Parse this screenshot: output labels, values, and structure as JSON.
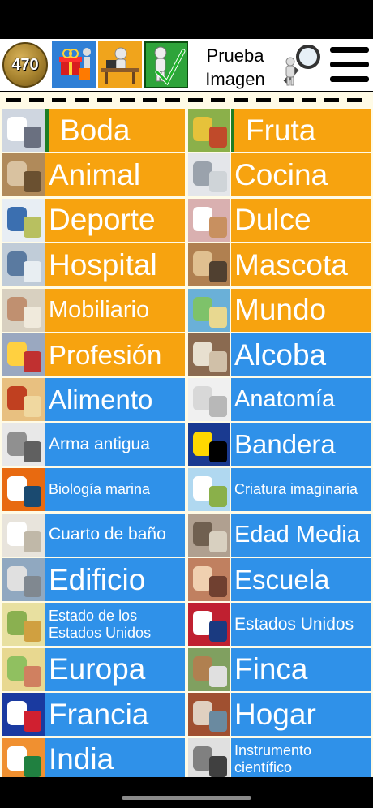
{
  "toolbar": {
    "coin_count": "470",
    "prueba_line1": "Prueba",
    "prueba_line2": "Imagen",
    "icons": [
      "gift-shop-icon",
      "desk-person-icon",
      "checkmark-person-icon",
      "magnifier-person-icon",
      "menu-icon"
    ]
  },
  "colors": {
    "orange": "#f7a30f",
    "blue": "#2f91e9",
    "selected_border": "#1d7d24",
    "background": "#fffbe6"
  },
  "categories": [
    {
      "label": "Boda",
      "color": "orange",
      "icon": "wedding-photo"
    },
    {
      "label": "Fruta",
      "color": "orange",
      "icon": "fruit-photo"
    },
    {
      "label": "Animal",
      "color": "orange",
      "icon": "animal-photo"
    },
    {
      "label": "Cocina",
      "color": "orange",
      "icon": "kitchen-photo"
    },
    {
      "label": "Deporte",
      "color": "orange",
      "icon": "sports-photo"
    },
    {
      "label": "Dulce",
      "color": "orange",
      "icon": "cake-photo"
    },
    {
      "label": "Hospital",
      "color": "orange",
      "icon": "hospital-photo"
    },
    {
      "label": "Mascota",
      "color": "orange",
      "icon": "cat-photo"
    },
    {
      "label": "Mobiliario",
      "color": "orange",
      "icon": "furniture-photo"
    },
    {
      "label": "Mundo",
      "color": "orange",
      "icon": "world-map-photo"
    },
    {
      "label": "Profesión",
      "color": "orange",
      "icon": "professions-photo"
    },
    {
      "label": "Alcoba",
      "color": "blue",
      "icon": "bedroom-photo"
    },
    {
      "label": "Alimento",
      "color": "blue",
      "icon": "pizza-photo"
    },
    {
      "label": "Anatomía",
      "color": "blue",
      "icon": "anatomy-photo"
    },
    {
      "label": "Arma antigua",
      "color": "blue",
      "icon": "ancient-weapon-photo"
    },
    {
      "label": "Bandera",
      "color": "blue",
      "icon": "flag-photo"
    },
    {
      "label": "Biología marina",
      "color": "blue",
      "icon": "clownfish-photo"
    },
    {
      "label": "Criatura imaginaria",
      "color": "blue",
      "icon": "pegasus-photo"
    },
    {
      "label": "Cuarto de baño",
      "color": "blue",
      "icon": "bathroom-photo"
    },
    {
      "label": "Edad Media",
      "color": "blue",
      "icon": "medieval-photo"
    },
    {
      "label": "Edificio",
      "color": "blue",
      "icon": "building-photo"
    },
    {
      "label": "Escuela",
      "color": "blue",
      "icon": "school-photo"
    },
    {
      "label": "Estado de los Estados Unidos",
      "color": "blue",
      "icon": "us-states-map-photo"
    },
    {
      "label": "Estados Unidos",
      "color": "blue",
      "icon": "us-map-flag-photo"
    },
    {
      "label": "Europa",
      "color": "blue",
      "icon": "europe-map-photo"
    },
    {
      "label": "Finca",
      "color": "blue",
      "icon": "farm-photo"
    },
    {
      "label": "Francia",
      "color": "blue",
      "icon": "france-flag-map-photo"
    },
    {
      "label": "Hogar",
      "color": "blue",
      "icon": "house-photo"
    },
    {
      "label": "India",
      "color": "blue",
      "icon": "india-map-photo"
    },
    {
      "label": "Instrumento científico",
      "color": "blue",
      "icon": "microscope-photo"
    }
  ]
}
